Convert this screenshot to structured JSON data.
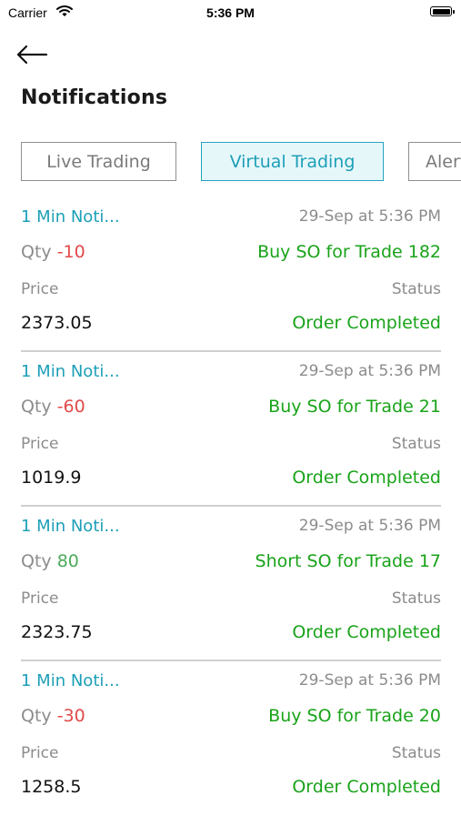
{
  "status_bar": {
    "carrier": "Carrier",
    "time": "5:36 PM"
  },
  "header": {
    "title": "Notifications"
  },
  "tabs": [
    {
      "label": "Live Trading",
      "active": false
    },
    {
      "label": "Virtual Trading",
      "active": true
    },
    {
      "label": "Alerts",
      "active": false
    }
  ],
  "notifications": [
    {
      "name": "1 Min Noti...",
      "datetime": "29-Sep at 5:36 PM",
      "qty_label": "Qty",
      "qty": "-10",
      "action": "Buy SO for Trade 182",
      "price_label": "Price",
      "status_label": "Status",
      "price": "2373.05",
      "status": "Order Completed"
    },
    {
      "name": "1 Min Noti...",
      "datetime": "29-Sep at 5:36 PM",
      "qty_label": "Qty",
      "qty": "-60",
      "action": "Buy SO for Trade 21",
      "price_label": "Price",
      "status_label": "Status",
      "price": "1019.9",
      "status": "Order Completed"
    },
    {
      "name": "1 Min Noti...",
      "datetime": "29-Sep at 5:36 PM",
      "qty_label": "Qty",
      "qty": "80",
      "action": "Short SO for Trade 17",
      "price_label": "Price",
      "status_label": "Status",
      "price": "2323.75",
      "status": "Order Completed"
    },
    {
      "name": "1 Min Noti...",
      "datetime": "29-Sep at 5:36 PM",
      "qty_label": "Qty",
      "qty": "-30",
      "action": "Buy SO for Trade 20",
      "price_label": "Price",
      "status_label": "Status",
      "price": "1258.5",
      "status": "Order Completed"
    }
  ],
  "colors": {
    "accent": "#1d9fb8",
    "negative": "#e14a4a",
    "positive": "#4bab5c",
    "success": "#19a319"
  },
  "icons": {
    "back": "arrow-left-icon",
    "wifi": "wifi-icon",
    "battery": "battery-icon"
  }
}
